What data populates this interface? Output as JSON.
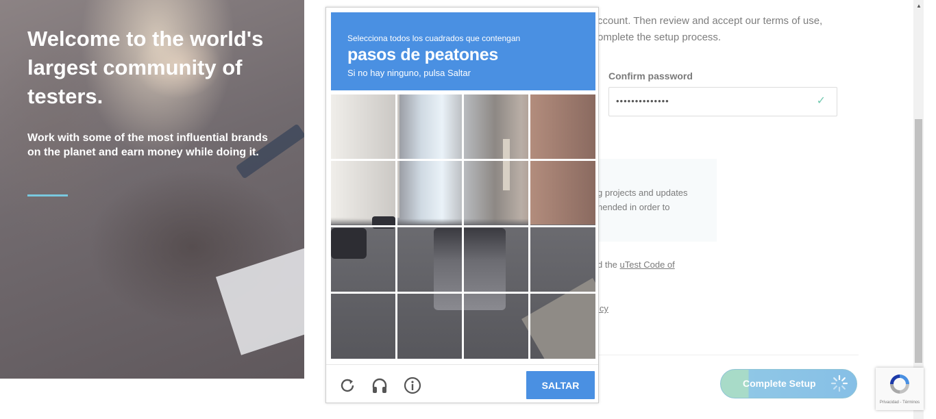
{
  "hero": {
    "title": "Welcome to the world's largest community of testers.",
    "subtitle": "Work with some of the most influential brands on the planet and earn money while doing it."
  },
  "form": {
    "intro_line1": "ccount. Then review and accept our terms of use,",
    "intro_line2": "omplete the setup process.",
    "confirm_password_label": "Confirm password",
    "confirm_password_value": "••••••••••••••",
    "info_line1": "g projects and updates",
    "info_line2": "nended in order to",
    "code_prefix": "d the ",
    "code_link": "uTest Code of",
    "policy_fragment": "icy",
    "complete_button": "Complete Setup"
  },
  "captcha": {
    "instruction": "Selecciona todos los cuadrados que contengan",
    "target": "pasos de peatones",
    "hint": "Si no hay ninguno, pulsa Saltar",
    "skip_button": "SALTAR",
    "grid_rows": 4,
    "grid_cols": 4,
    "icons": [
      "reload-icon",
      "audio-icon",
      "info-icon"
    ]
  },
  "recaptcha_badge": {
    "terms": "Privacidad - Términos"
  },
  "colors": {
    "captcha_blue": "#4a90e2",
    "accent_line": "#79c9df",
    "check_green": "#73c9b0"
  }
}
